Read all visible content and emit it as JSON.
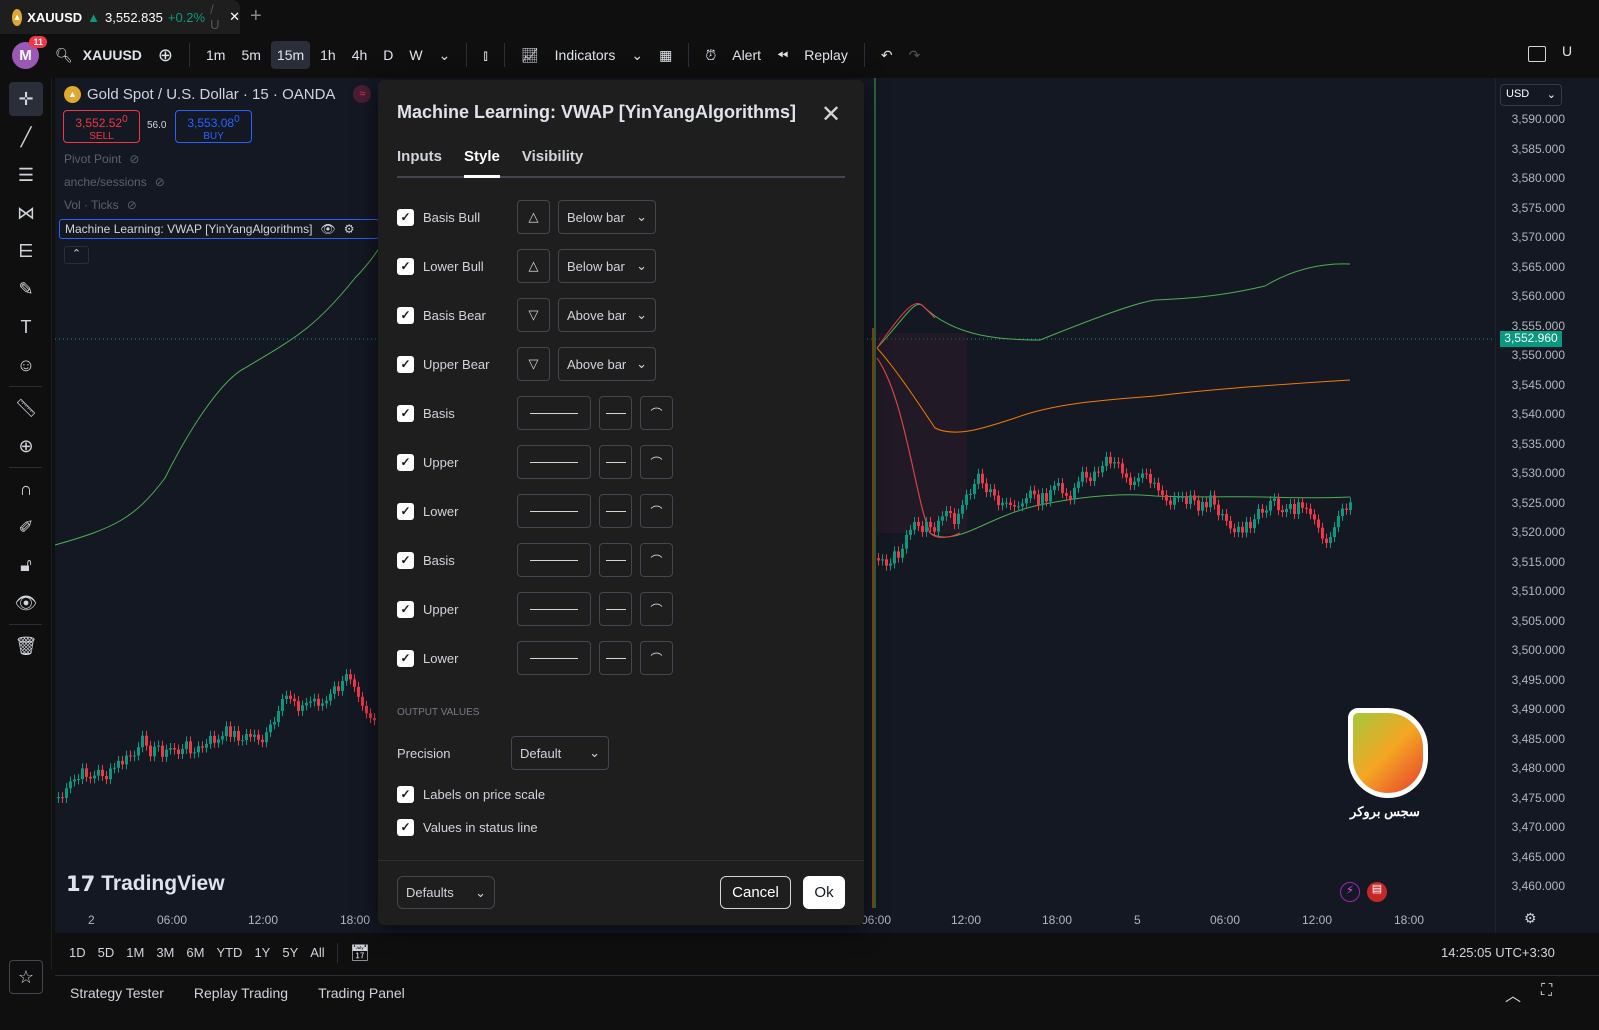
{
  "tab": {
    "symbol": "XAUUSD",
    "price": "3,552.835",
    "change": "+0.2%",
    "suffix": "/ U",
    "add": "+"
  },
  "toolbar": {
    "avatar": "M",
    "notif": "11",
    "search": "XAUUSD",
    "intervals": [
      "1m",
      "5m",
      "15m",
      "1h",
      "4h",
      "D",
      "W"
    ],
    "active_interval": "15m",
    "indicators": "Indicators",
    "alert": "Alert",
    "replay": "Replay",
    "right_text": "U"
  },
  "legend": {
    "title": "Gold Spot / U.S. Dollar · 15 · OANDA",
    "sell_price": "3,552.52",
    "sell_sup": "0",
    "sell": "SELL",
    "spread": "56.0",
    "buy_price": "3,553.08",
    "buy_sup": "0",
    "buy": "BUY",
    "indicators": [
      "Pivot Point",
      "anche/sessions",
      "Vol · Ticks"
    ],
    "active_indicator": "Machine Learning: VWAP [YinYangAlgorithms]"
  },
  "price_scale": {
    "currency": "USD",
    "labels": [
      "3,590.000",
      "3,585.000",
      "3,580.000",
      "3,575.000",
      "3,570.000",
      "3,565.000",
      "3,560.000",
      "3,555.000",
      "3,550.000",
      "3,545.000",
      "3,540.000",
      "3,535.000",
      "3,530.000",
      "3,525.000",
      "3,520.000",
      "3,515.000",
      "3,510.000",
      "3,505.000",
      "3,500.000",
      "3,495.000",
      "3,490.000",
      "3,485.000",
      "3,480.000",
      "3,475.000",
      "3,470.000",
      "3,465.000",
      "3,460.000"
    ],
    "last": "3,552.960"
  },
  "time_axis": [
    "2",
    "06:00",
    "12:00",
    "18:00",
    "06:00",
    "12:00",
    "18:00",
    "5",
    "06:00",
    "12:00",
    "18:00"
  ],
  "watermark": "TradingView",
  "logo_text": "سجس بروکر",
  "bottombar": {
    "ranges": [
      "1D",
      "5D",
      "1M",
      "3M",
      "6M",
      "YTD",
      "1Y",
      "5Y",
      "All"
    ],
    "clock": "14:25:05 UTC+3:30"
  },
  "bottompanel": [
    "Strategy Tester",
    "Replay Trading",
    "Trading Panel"
  ],
  "dialog": {
    "title": "Machine Learning: VWAP [YinYangAlgorithms]",
    "tabs": [
      "Inputs",
      "Style",
      "Visibility"
    ],
    "active_tab": "Style",
    "shape_rows": [
      {
        "label": "Basis Bull",
        "shape": "△",
        "position": "Below bar"
      },
      {
        "label": "Lower Bull",
        "shape": "△",
        "position": "Below bar"
      },
      {
        "label": "Basis Bear",
        "shape": "▽",
        "position": "Above bar"
      },
      {
        "label": "Upper Bear",
        "shape": "▽",
        "position": "Above bar"
      }
    ],
    "line_rows": [
      "Basis",
      "Upper",
      "Lower",
      "Basis",
      "Upper",
      "Lower"
    ],
    "output_values": "OUTPUT VALUES",
    "precision_label": "Precision",
    "precision_value": "Default",
    "labels_on_price_scale": "Labels on price scale",
    "values_in_status_line": "Values in status line",
    "defaults": "Defaults",
    "cancel": "Cancel",
    "ok": "Ok"
  },
  "colors": {
    "bull": "#089981",
    "bear": "#f23645",
    "band": "#4caf50",
    "basis": "#f57c00",
    "dialog_bg": "#1e1e1e"
  }
}
